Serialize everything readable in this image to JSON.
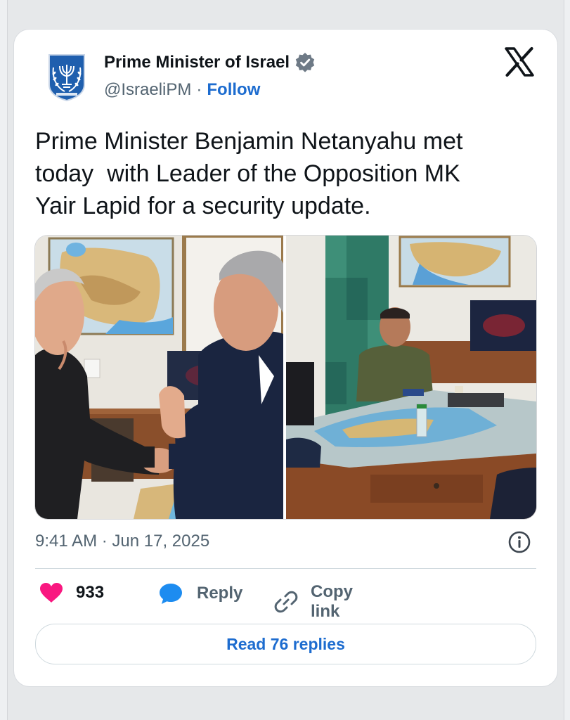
{
  "author": {
    "name": "Prime Minister of Israel",
    "handle": "@IsraeliPM",
    "separator": "·",
    "follow_label": "Follow",
    "verified_icon": "verified-badge-icon",
    "avatar": "israel-emblem-avatar"
  },
  "platform_icon": "x-logo-icon",
  "tweet": {
    "text": "Prime Minister Benjamin Netanyahu met\ntoday  with Leader of the Opposition MK\nYair Lapid for a security update."
  },
  "media": {
    "left_image": "photo-handshake",
    "right_image": "photo-meeting-room"
  },
  "meta": {
    "timestamp": "9:41 AM · Jun 17, 2025",
    "info_icon": "info-icon"
  },
  "actions": {
    "like_count": "933",
    "reply_label": "Reply",
    "copy_link_label": "Copy link"
  },
  "read_replies_label": "Read 76 replies",
  "colors": {
    "accent": "#1d6ccf",
    "like": "#f91880",
    "verified": "#6e7a86",
    "text": "#0f1419",
    "muted": "#536471"
  }
}
